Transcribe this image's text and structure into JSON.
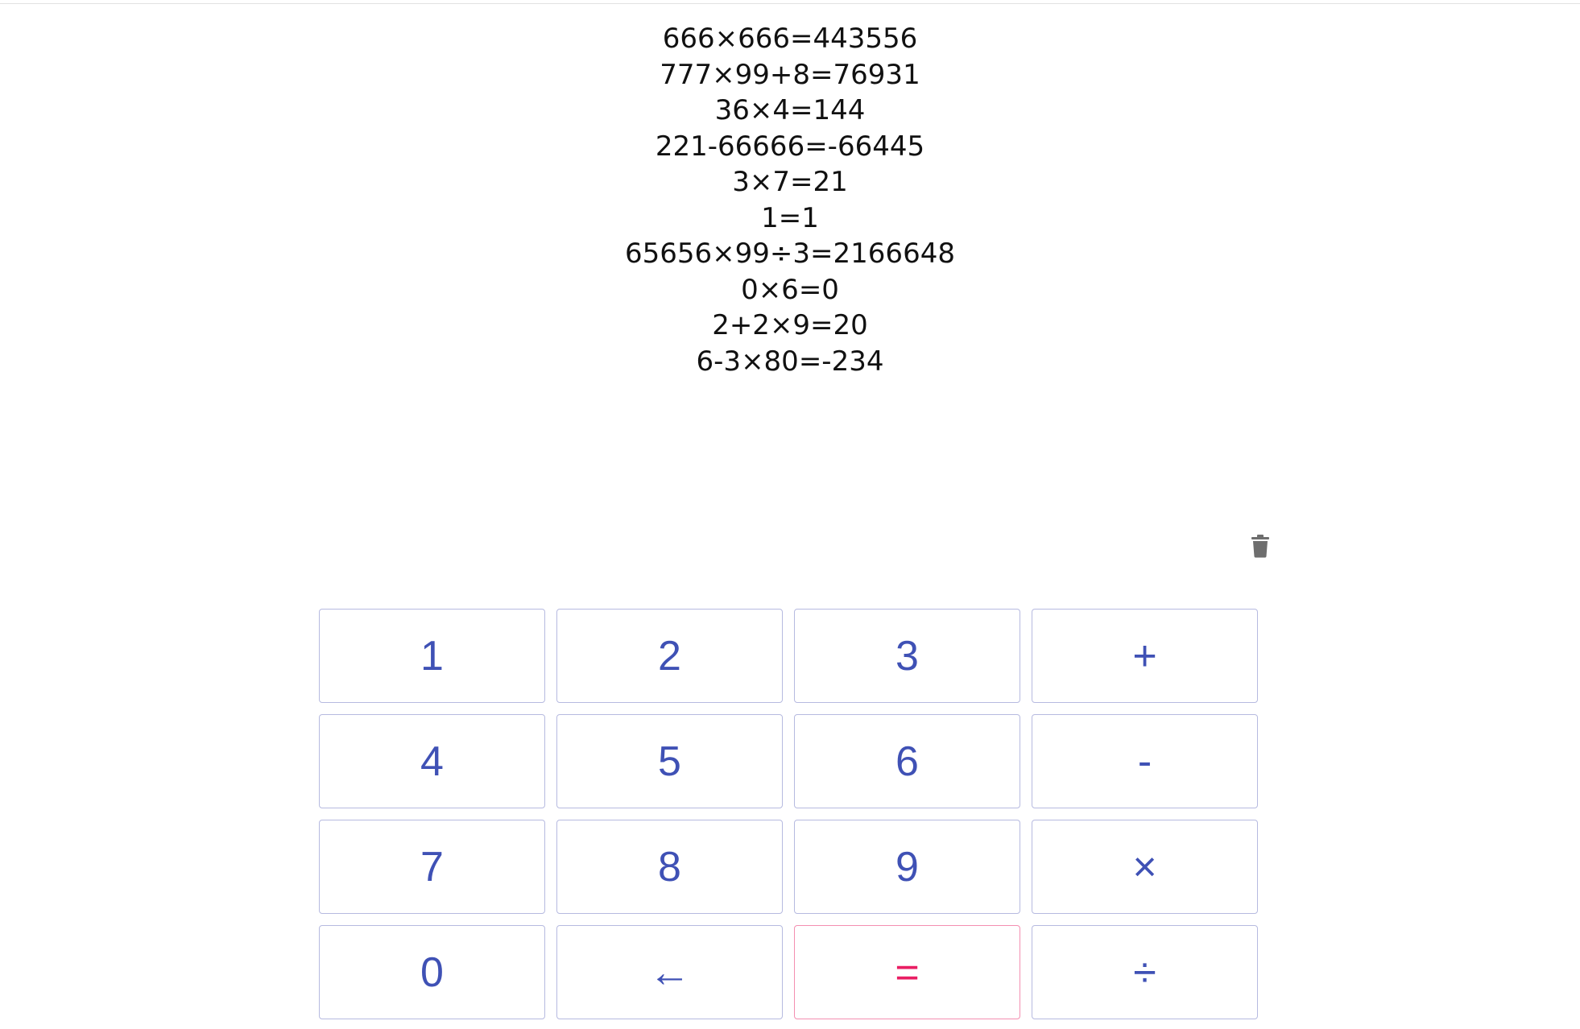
{
  "history": [
    "666×666=443556",
    "777×99+8=76931",
    "36×4=144",
    "221-66666=-66445",
    "3×7=21",
    "1=1",
    "65656×99÷3=2166648",
    "0×6=0",
    "2+2×9=20",
    "6-3×80=-234"
  ],
  "toolbar": {
    "clear_icon": "trash-icon"
  },
  "keypad": {
    "keys": [
      "1",
      "2",
      "3",
      "+",
      "4",
      "5",
      "6",
      "-",
      "7",
      "8",
      "9",
      "×",
      "0",
      "←",
      "=",
      "÷"
    ]
  },
  "colors": {
    "key_text": "#3f51b5",
    "key_border": "#b6bae0",
    "equals_text": "#e91e63",
    "equals_border": "#f48fb1",
    "icon": "#6e6e6e"
  }
}
